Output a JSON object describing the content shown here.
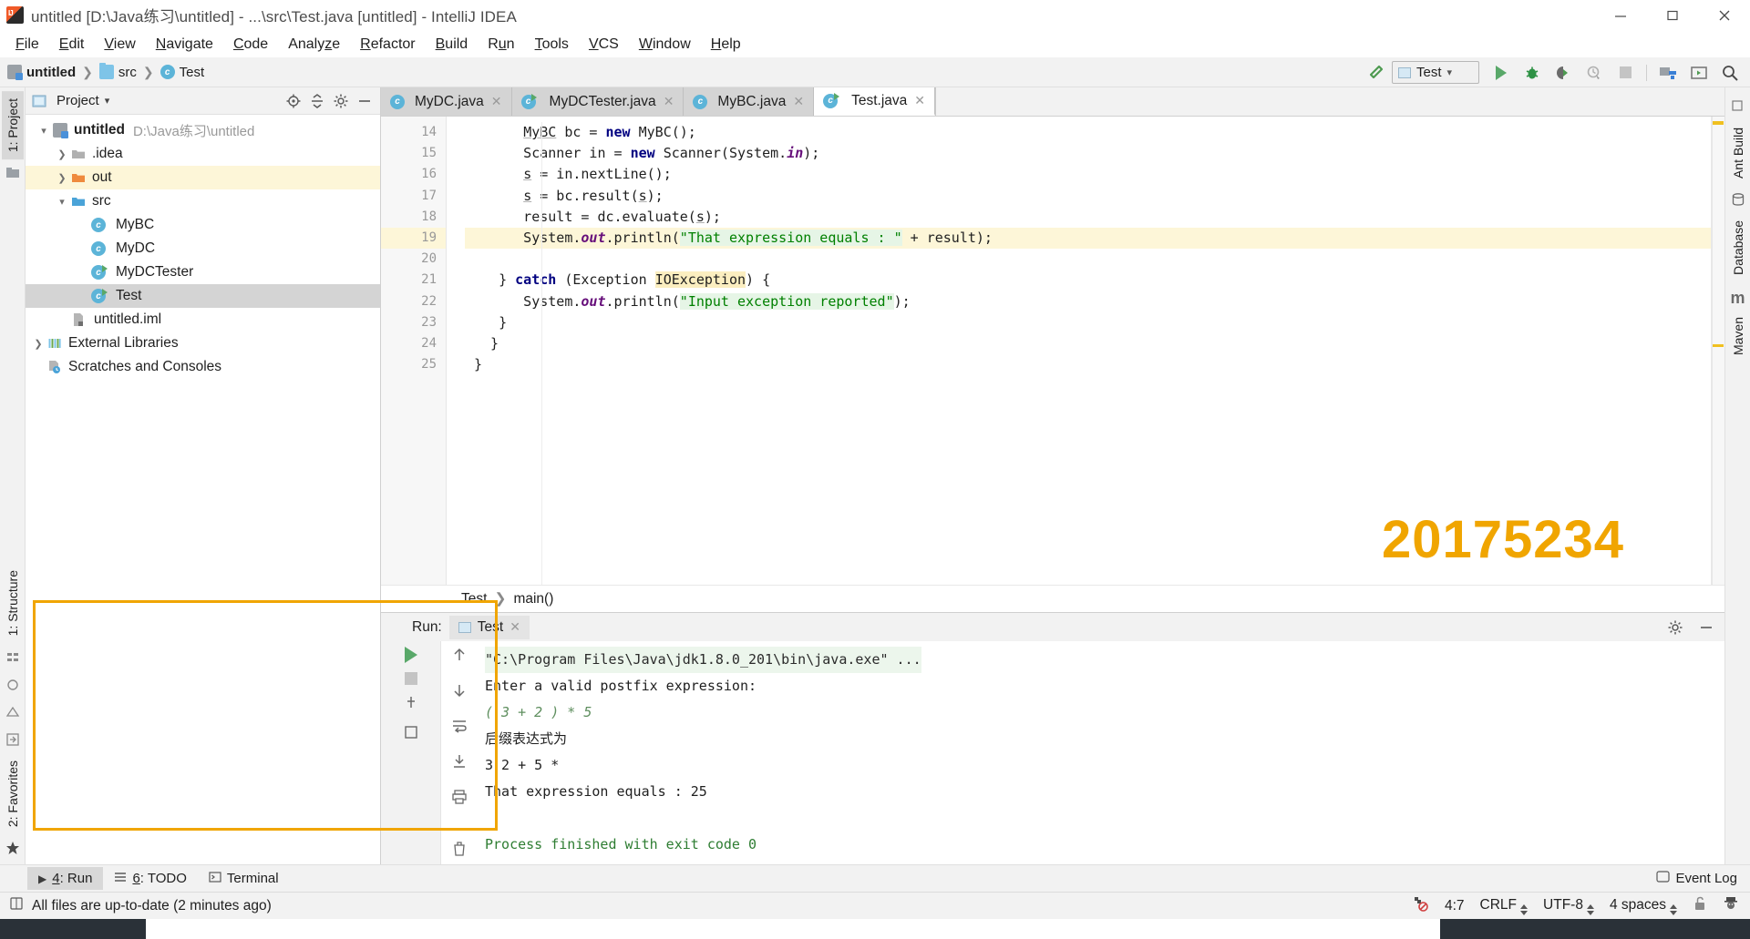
{
  "window": {
    "title": "untitled [D:\\Java练习\\untitled] - ...\\src\\Test.java [untitled] - IntelliJ IDEA",
    "minimize": "−",
    "maximize": "□",
    "close": "×"
  },
  "menubar": [
    "File",
    "Edit",
    "View",
    "Navigate",
    "Code",
    "Analyze",
    "Refactor",
    "Build",
    "Run",
    "Tools",
    "VCS",
    "Window",
    "Help"
  ],
  "breadcrumb": {
    "project": "untitled",
    "folder": "src",
    "file": "Test"
  },
  "toolbar": {
    "run_config": "Test",
    "build_icon": "hammer-icon",
    "run_icon": "run-icon",
    "debug_icon": "debug-icon",
    "run_coverage_icon": "run-with-coverage-icon",
    "profile_icon": "profile-icon",
    "stop_icon": "stop-icon",
    "project_structure_icon": "project-structure-icon",
    "terminal_icon": "open-terminal-icon",
    "search_icon": "search-everywhere-icon"
  },
  "left_rail": {
    "tabs": [
      "1: Project"
    ],
    "bottom_tabs": [
      "1: Structure",
      "2: Favorites"
    ]
  },
  "right_rail": {
    "tabs": [
      "Ant Build",
      "Database",
      "Maven"
    ]
  },
  "project_panel": {
    "title": "Project",
    "locate_icon": "locate-file-icon",
    "collapse_icon": "collapse-all-icon",
    "settings_icon": "gear-icon",
    "hide_icon": "hide-icon",
    "tree": [
      {
        "label": "untitled",
        "sub": "D:\\Java练习\\untitled",
        "icon": "module-icon",
        "arrow": "expanded",
        "indent": 0,
        "bold": true,
        "state": "normal"
      },
      {
        "label": ".idea",
        "sub": "",
        "icon": "folder-icon",
        "arrow": "collapsed",
        "indent": 1,
        "bold": false,
        "state": "normal"
      },
      {
        "label": "out",
        "sub": "",
        "icon": "folder-orange-icon",
        "arrow": "collapsed",
        "indent": 1,
        "bold": false,
        "state": "highlight"
      },
      {
        "label": "src",
        "sub": "",
        "icon": "source-folder-icon",
        "arrow": "expanded",
        "indent": 1,
        "bold": false,
        "state": "normal"
      },
      {
        "label": "MyBC",
        "sub": "",
        "icon": "java-class-icon",
        "arrow": "none",
        "indent": 2,
        "bold": false,
        "state": "normal"
      },
      {
        "label": "MyDC",
        "sub": "",
        "icon": "java-class-icon",
        "arrow": "none",
        "indent": 2,
        "bold": false,
        "state": "normal"
      },
      {
        "label": "MyDCTester",
        "sub": "",
        "icon": "java-runnable-class-icon",
        "arrow": "none",
        "indent": 2,
        "bold": false,
        "state": "normal"
      },
      {
        "label": "Test",
        "sub": "",
        "icon": "java-runnable-class-icon",
        "arrow": "none",
        "indent": 2,
        "bold": false,
        "state": "selected"
      },
      {
        "label": "untitled.iml",
        "sub": "",
        "icon": "iml-file-icon",
        "arrow": "none",
        "indent": 1,
        "bold": false,
        "state": "normal"
      },
      {
        "label": "External Libraries",
        "sub": "",
        "icon": "libraries-icon",
        "arrow": "collapsed",
        "indent": 0,
        "bold": false,
        "state": "normal"
      },
      {
        "label": "Scratches and Consoles",
        "sub": "",
        "icon": "scratches-icon",
        "arrow": "none",
        "indent": 0,
        "bold": false,
        "state": "normal"
      }
    ]
  },
  "editor": {
    "tabs": [
      {
        "label": "MyDC.java",
        "icon": "java-class-icon",
        "active": false
      },
      {
        "label": "MyDCTester.java",
        "icon": "java-runnable-class-icon",
        "active": false
      },
      {
        "label": "MyBC.java",
        "icon": "java-class-icon",
        "active": false
      },
      {
        "label": "Test.java",
        "icon": "java-runnable-class-icon",
        "active": true
      }
    ],
    "lines": [
      {
        "n": "14",
        "text": "MyBC bc = new MyBC();"
      },
      {
        "n": "15",
        "text": "Scanner in = new Scanner(System.in);"
      },
      {
        "n": "16",
        "text": "s = in.nextLine();"
      },
      {
        "n": "17",
        "text": "s = bc.result(s);"
      },
      {
        "n": "18",
        "text": "result = dc.evaluate(s);"
      },
      {
        "n": "19",
        "text": "System.out.println(\"That expression equals : \" + result);"
      },
      {
        "n": "20",
        "text": ""
      },
      {
        "n": "21",
        "text": "} catch (Exception IOException) {"
      },
      {
        "n": "22",
        "text": "System.out.println(\"Input exception reported\");"
      },
      {
        "n": "23",
        "text": "}"
      },
      {
        "n": "24",
        "text": "}"
      },
      {
        "n": "25",
        "text": "}"
      }
    ],
    "highlight_line": "19",
    "string_19": "That expression equals : ",
    "string_22": "Input exception reported",
    "exception_token": "IOException",
    "breadcrumb": {
      "class": "Test",
      "method": "main()"
    },
    "watermark": "20175234"
  },
  "run_panel": {
    "label": "Run:",
    "tab": "Test",
    "tab_close": "×",
    "settings_icon": "gear-icon",
    "hide_icon": "hide-icon",
    "tools": [
      "rerun-icon",
      "stop-icon",
      "up-icon",
      "down-icon",
      "soft-wrap-icon",
      "scroll-to-end-icon",
      "print-icon",
      "clear-all-icon"
    ],
    "console_lines": [
      {
        "text": "\"C:\\Program Files\\Java\\jdk1.8.0_201\\bin\\java.exe\" ...",
        "style": "command"
      },
      {
        "text": "Enter a valid postfix expression:",
        "style": "output"
      },
      {
        "text": "( 3 + 2 ) * 5",
        "style": "input"
      },
      {
        "text": "后缀表达式为",
        "style": "output-cn"
      },
      {
        "text": "3 2 + 5 *",
        "style": "output"
      },
      {
        "text": "That expression equals : 25",
        "style": "output"
      },
      {
        "text": "",
        "style": "blank"
      },
      {
        "text": "Process finished with exit code 0",
        "style": "exit"
      }
    ],
    "highlight_color": "#f0a500"
  },
  "toolwindow_bar": {
    "items": [
      {
        "num": "4",
        "label": ": Run",
        "icon": "run-icon",
        "active": true
      },
      {
        "num": "6",
        "label": ": TODO",
        "icon": "todo-icon",
        "active": false
      },
      {
        "num": "",
        "label": "Terminal",
        "icon": "terminal-icon",
        "active": false
      }
    ],
    "event_log": "Event Log",
    "event_log_icon": "event-log-icon"
  },
  "status_bar": {
    "message": "All files are up-to-date (2 minutes ago)",
    "message_icon": "book-icon",
    "inspection_icon": "inspections-off-icon",
    "caret": "4:7",
    "line_separator": "CRLF",
    "encoding": "UTF-8",
    "indent": "4 spaces",
    "lock_icon": "unlock-icon",
    "hector_icon": "hector-icon"
  }
}
